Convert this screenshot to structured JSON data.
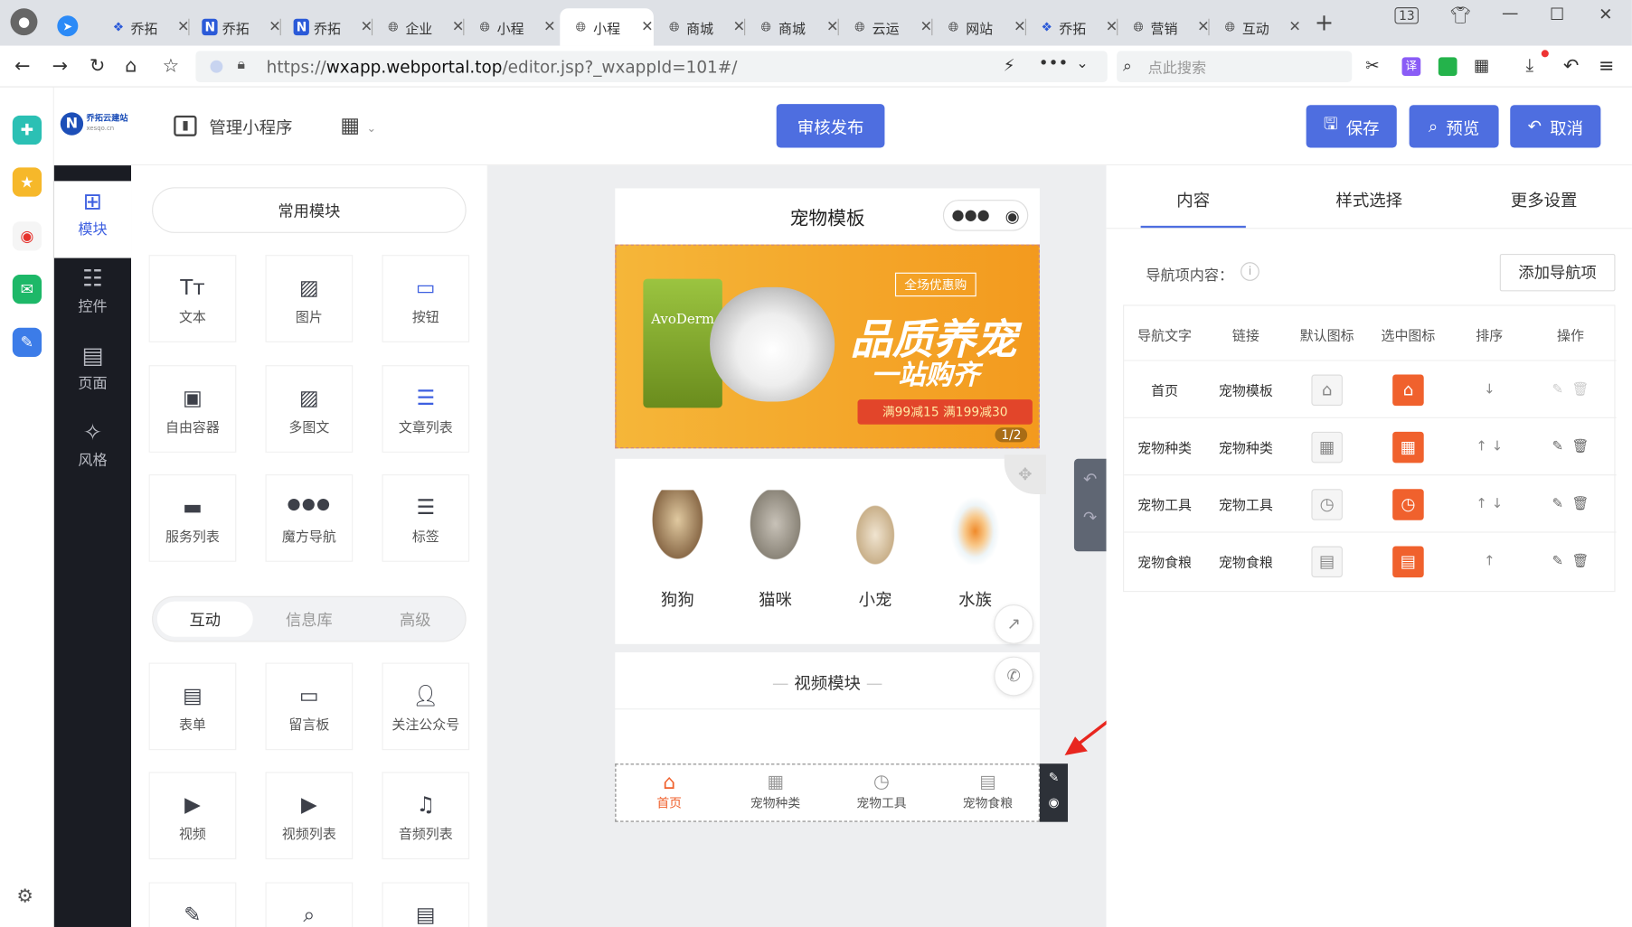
{
  "browser": {
    "tabs": [
      {
        "label": "乔拓"
      },
      {
        "label": "乔拓"
      },
      {
        "label": "乔拓"
      },
      {
        "label": "企业"
      },
      {
        "label": "小程"
      },
      {
        "label": "小程",
        "active": true
      },
      {
        "label": "商城"
      },
      {
        "label": "商城"
      },
      {
        "label": "云运"
      },
      {
        "label": "网站"
      },
      {
        "label": "乔拓"
      },
      {
        "label": "营销"
      },
      {
        "label": "互动"
      }
    ],
    "tab_count": "13",
    "url_prefix": "https://",
    "url_domain": "wxapp.webportal.top",
    "url_path": "/editor.jsp?_wxappId=101#/",
    "search_placeholder": "点此搜索"
  },
  "header": {
    "logo_name": "乔拓云建站",
    "logo_sub": "xesqo.cn",
    "manage_label": "管理小程序",
    "publish_label": "审核发布",
    "save_label": "保存",
    "preview_label": "预览",
    "cancel_label": "取消"
  },
  "sidebar": {
    "items": [
      {
        "label": "模块",
        "icon": "plus-square-icon",
        "active": true
      },
      {
        "label": "控件",
        "icon": "sliders-icon"
      },
      {
        "label": "页面",
        "icon": "page-stack-icon"
      },
      {
        "label": "风格",
        "icon": "magic-wand-icon"
      }
    ]
  },
  "modules": {
    "common_title": "常用模块",
    "common": [
      {
        "label": "文本",
        "icon": "text-icon"
      },
      {
        "label": "图片",
        "icon": "image-icon"
      },
      {
        "label": "按钮",
        "icon": "button-icon"
      },
      {
        "label": "自由容器",
        "icon": "container-icon"
      },
      {
        "label": "多图文",
        "icon": "multi-image-icon"
      },
      {
        "label": "文章列表",
        "icon": "article-list-icon"
      },
      {
        "label": "服务列表",
        "icon": "service-list-icon"
      },
      {
        "label": "魔方导航",
        "icon": "dots-grid-icon"
      },
      {
        "label": "标签",
        "icon": "tag-icon"
      }
    ],
    "tabs": [
      {
        "label": "互动",
        "active": true
      },
      {
        "label": "信息库"
      },
      {
        "label": "高级"
      }
    ],
    "interactive": [
      {
        "label": "表单",
        "icon": "form-icon"
      },
      {
        "label": "留言板",
        "icon": "message-board-icon"
      },
      {
        "label": "关注公众号",
        "icon": "follow-icon"
      },
      {
        "label": "视频",
        "icon": "video-icon"
      },
      {
        "label": "视频列表",
        "icon": "video-list-icon"
      },
      {
        "label": "音频列表",
        "icon": "audio-list-icon"
      }
    ]
  },
  "phone": {
    "title": "宠物模板",
    "banner": {
      "tag": "全场优惠购",
      "headline1": "品质养宠",
      "headline2": "一站购齐",
      "promo": "满99减15 满199减30",
      "page_indicator": "1/2",
      "brand": "AvoDerm"
    },
    "categories": [
      {
        "label": "狗狗"
      },
      {
        "label": "猫咪"
      },
      {
        "label": "小宠"
      },
      {
        "label": "水族"
      }
    ],
    "video_title": "视频模块",
    "tabbar": [
      {
        "label": "首页",
        "active": true
      },
      {
        "label": "宠物种类"
      },
      {
        "label": "宠物工具"
      },
      {
        "label": "宠物食粮"
      }
    ]
  },
  "right": {
    "tabs": [
      {
        "label": "内容",
        "active": true
      },
      {
        "label": "样式选择"
      },
      {
        "label": "更多设置"
      }
    ],
    "nav_label": "导航项内容：",
    "add_button": "添加导航项",
    "columns": [
      "导航文字",
      "链接",
      "默认图标",
      "选中图标",
      "排序",
      "操作"
    ],
    "rows": [
      {
        "text": "首页",
        "link": "宠物模板",
        "icon": "home-icon",
        "sort": "↓"
      },
      {
        "text": "宠物种类",
        "link": "宠物种类",
        "icon": "grid-icon",
        "sort": "↑ ↓"
      },
      {
        "text": "宠物工具",
        "link": "宠物工具",
        "icon": "clock-icon",
        "sort": "↑ ↓"
      },
      {
        "text": "宠物食粮",
        "link": "宠物食粮",
        "icon": "doc-icon",
        "sort": "↑"
      }
    ]
  },
  "colors": {
    "accent": "#4e6ee0",
    "orange": "#f0612d",
    "dark": "#1a1c23"
  }
}
